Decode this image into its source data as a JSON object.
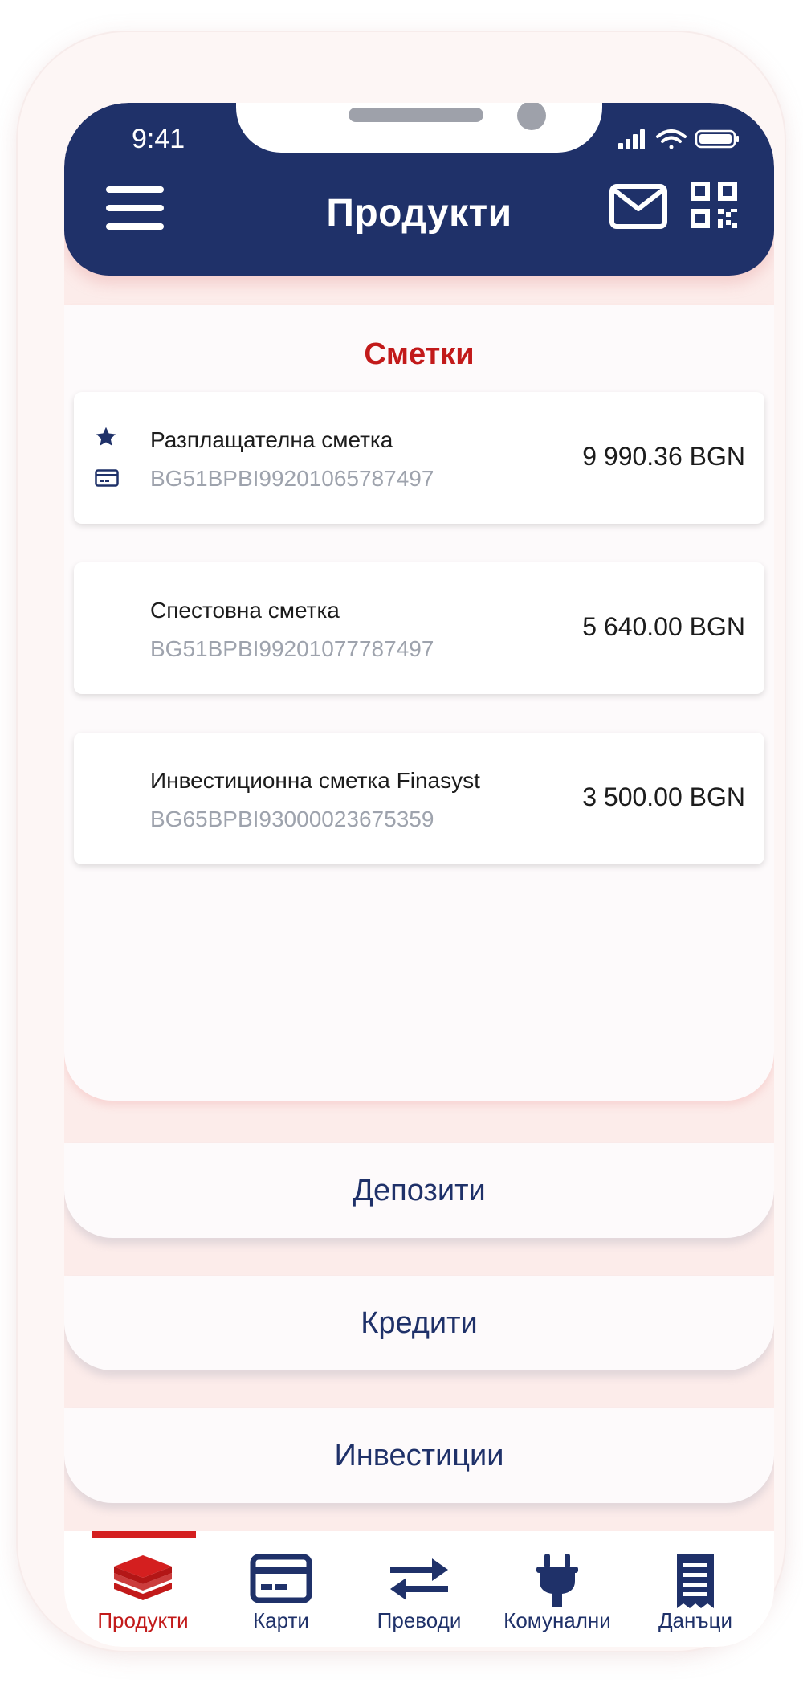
{
  "status_bar": {
    "time": "9:41"
  },
  "header": {
    "title": "Продукти"
  },
  "accounts": {
    "section_title": "Сметки",
    "items": [
      {
        "name": "Разплащателна сметка",
        "iban": "BG51BPBI99201065787497",
        "amount": "9 990.36 BGN",
        "favorite": true
      },
      {
        "name": "Спестовна сметка",
        "iban": "BG51BPBI99201077787497",
        "amount": "5 640.00 BGN"
      },
      {
        "name": "Инвестиционна сметка Finasyst",
        "iban": "BG65BPBI93000023675359",
        "amount": "3 500.00 BGN"
      }
    ]
  },
  "sections": [
    {
      "label": "Депозити"
    },
    {
      "label": "Кредити"
    },
    {
      "label": "Инвестиции"
    }
  ],
  "bottom_nav": {
    "items": [
      {
        "label": "Продукти",
        "icon": "layers-icon",
        "active": true
      },
      {
        "label": "Карти",
        "icon": "card-icon"
      },
      {
        "label": "Преводи",
        "icon": "transfer-icon"
      },
      {
        "label": "Комунални",
        "icon": "plug-icon"
      },
      {
        "label": "Данъци",
        "icon": "receipt-icon"
      }
    ]
  },
  "colors": {
    "primary": "#1f3169",
    "accent": "#c21a1a",
    "muted": "#9ea3ad"
  }
}
